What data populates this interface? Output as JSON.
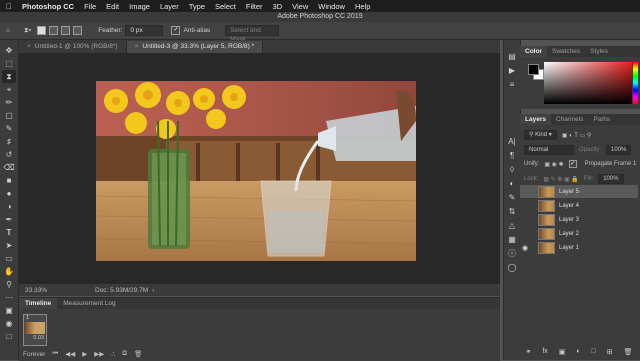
{
  "menubar": {
    "app": "Photoshop CC",
    "items": [
      "File",
      "Edit",
      "Image",
      "Layer",
      "Type",
      "Select",
      "Filter",
      "3D",
      "View",
      "Window",
      "Help"
    ]
  },
  "window": {
    "title": "Adobe Photoshop CC 2019"
  },
  "options_bar": {
    "feather_label": "Feather:",
    "feather_value": "0 px",
    "antialias_label": "Anti-alias",
    "select_mask_label": "Select and Mask..."
  },
  "tabs": [
    {
      "label": "Untitled-1 @ 100% (RGB/8*)",
      "active": false
    },
    {
      "label": "Untitled-3 @ 33.3% (Layer 5, RGB/8) *",
      "active": true
    }
  ],
  "status": {
    "zoom": "33.33%",
    "doc": "Doc: 5.93M/29.7M"
  },
  "timeline": {
    "tabs": [
      "Timeline",
      "Measurement Log"
    ],
    "frame_number": "1",
    "frame_duration": "0.03",
    "loop": "Forever"
  },
  "color_panel": {
    "tabs": [
      "Color",
      "Swatches",
      "Styles"
    ],
    "fg_color": "#000000",
    "bg_color": "#ffffff"
  },
  "layers_panel": {
    "tabs": [
      "Layers",
      "Channels",
      "Paths"
    ],
    "kind_label": "Kind",
    "blend_mode": "Normal",
    "opacity_label": "Opacity:",
    "opacity_value": "100%",
    "unify_label": "Unify:",
    "propagate_label": "Propagate Frame 1",
    "lock_label": "Lock:",
    "fill_label": "Fill:",
    "fill_value": "100%",
    "layers": [
      {
        "name": "Layer 5",
        "selected": true,
        "visible": false
      },
      {
        "name": "Layer 4",
        "selected": false,
        "visible": false
      },
      {
        "name": "Layer 3",
        "selected": false,
        "visible": false
      },
      {
        "name": "Layer 2",
        "selected": false,
        "visible": false
      },
      {
        "name": "Layer 1",
        "selected": false,
        "visible": true
      }
    ]
  }
}
